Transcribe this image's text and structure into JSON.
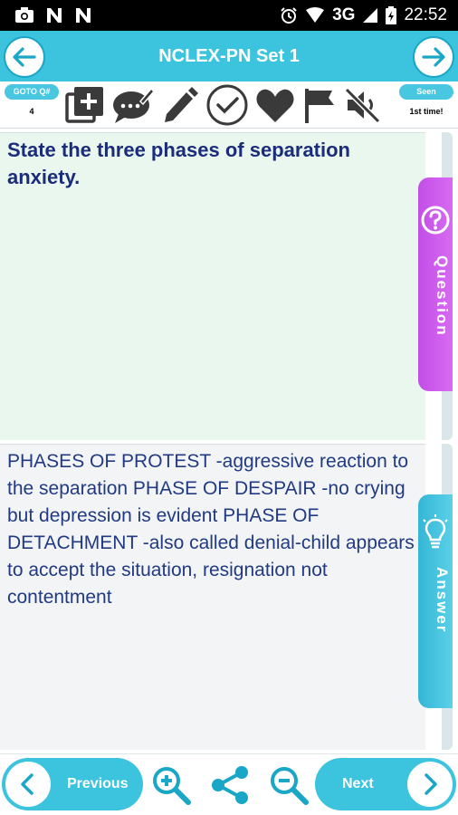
{
  "status_bar": {
    "network": "3G",
    "time": "22:52",
    "icons": [
      "camera-icon",
      "n-notification-icon",
      "n-notification-icon",
      "alarm-icon",
      "wifi-icon",
      "signal-icon",
      "battery-icon"
    ]
  },
  "header": {
    "title": "NCLEX-PN Set 1",
    "back_icon": "arrow-left-icon",
    "forward_icon": "arrow-right-icon"
  },
  "toolbar": {
    "goto_label": "GOTO Q#",
    "goto_value": "4",
    "seen_label": "Seen",
    "seen_value": "1st time!",
    "icons": [
      "add-note-icon",
      "comment-edit-icon",
      "pencil-icon",
      "check-circle-icon",
      "heart-icon",
      "flag-icon",
      "mute-icon"
    ]
  },
  "question": {
    "text": "State the three phases of separation anxiety.",
    "tab_label": "Question"
  },
  "answer": {
    "text": "PHASES OF PROTEST -aggressive reaction to the separation PHASE OF DESPAIR -no crying but depression is evident PHASE OF DETACHMENT -also called denial-child appears to accept the situation, resignation not contentment",
    "tab_label": "Answer"
  },
  "bottom_bar": {
    "previous_label": "Previous",
    "next_label": "Next",
    "icons": [
      "zoom-in-icon",
      "share-icon",
      "zoom-out-icon"
    ]
  },
  "colors": {
    "accent": "#3cc4de",
    "question_tab": "#c24ee8",
    "answer_tab": "#34b6d6",
    "question_bg": "#eaf7ee",
    "question_text": "#1a2c7a"
  }
}
